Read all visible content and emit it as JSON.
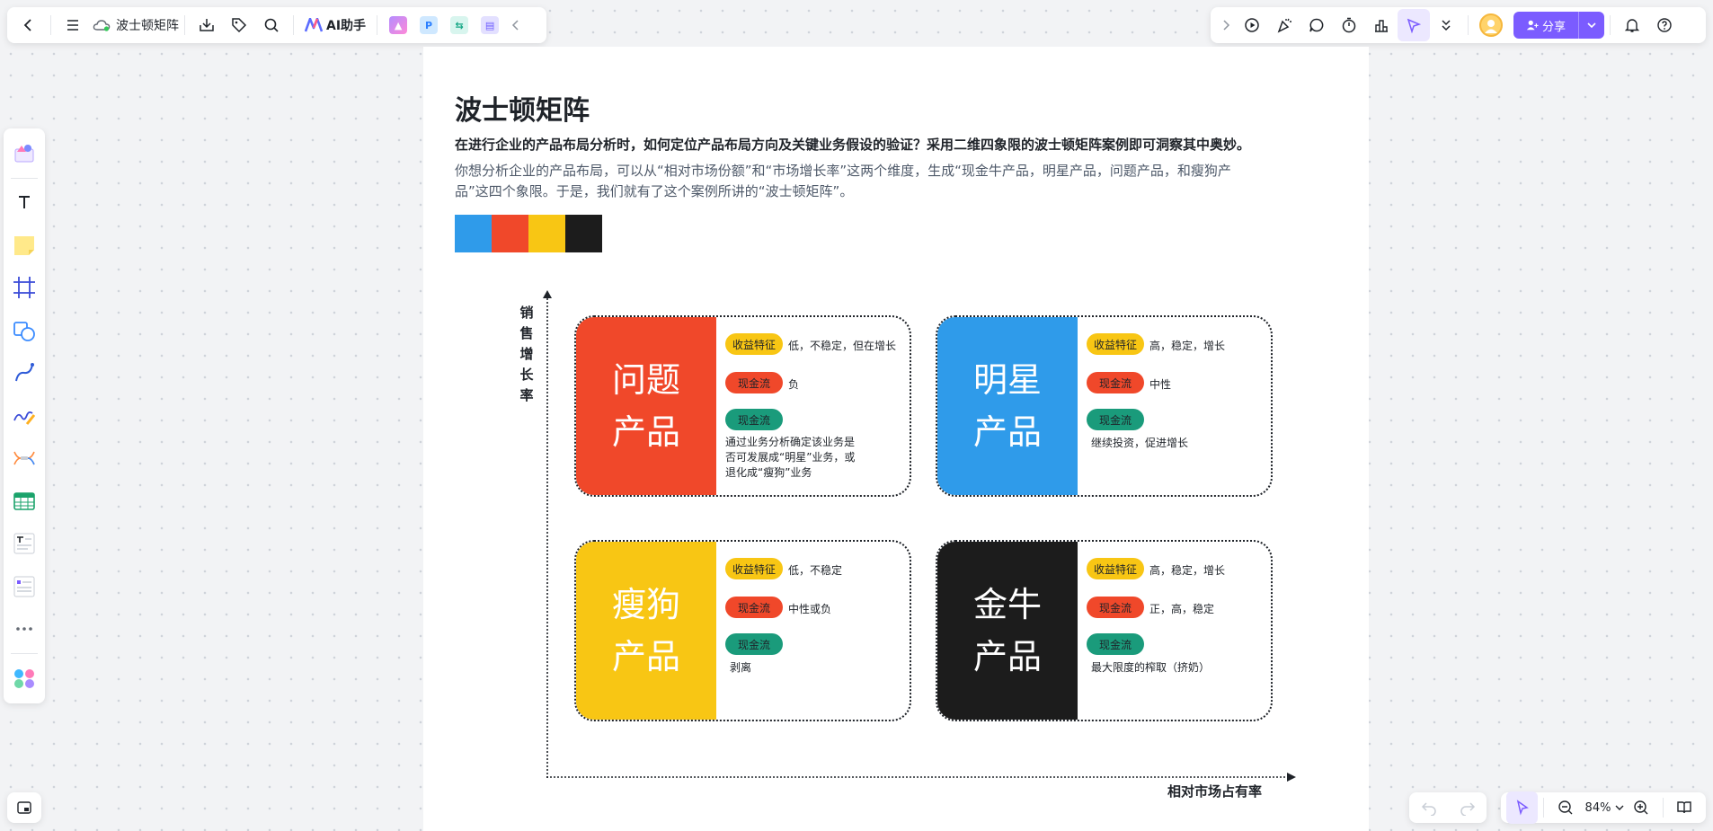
{
  "toolbar": {
    "doc_title": "波士顿矩阵",
    "ai_label": "AI助手"
  },
  "topbar_right": {
    "share_label": "分享"
  },
  "zoom": {
    "level": "84%"
  },
  "document": {
    "title": "波士顿矩阵",
    "lead": "在进行企业的产品布局分析时，如何定位产品布局方向及关键业务假设的验证？采用二维四象限的波士顿矩阵案例即可洞察其中奥妙。",
    "paragraph": "你想分析企业的产品布局，可以从“相对市场份额”和“市场增长率”这两个维度，生成“现金牛产品，明星产品，问题产品，和瘦狗产品”这四个象限。于是，我们就有了这个案例所讲的“波士顿矩阵”。",
    "swatches": [
      "#2f9bea",
      "#f0482a",
      "#f8c614",
      "#1c1c1c"
    ]
  },
  "matrix": {
    "y_axis_label": "销售增长率",
    "x_axis_label": "相对市场占有率",
    "pill_labels": {
      "revenue": "收益特征",
      "cashflow": "现金流"
    },
    "quadrants": {
      "question": {
        "title_line1": "问题",
        "title_line2": "产品",
        "color": "#f0482a",
        "revenue": "低，不稳定，但在增长",
        "cashflow": "负",
        "strategy": "通过业务分析确定该业务是否可发展成“明星”业务，或退化成“瘦狗”业务"
      },
      "star": {
        "title_line1": "明星",
        "title_line2": "产品",
        "color": "#2f9bea",
        "revenue": "高，稳定，增长",
        "cashflow": "中性",
        "strategy": "继续投资，促进增长"
      },
      "dog": {
        "title_line1": "瘦狗",
        "title_line2": "产品",
        "color": "#f8c614",
        "revenue": "低，不稳定",
        "cashflow": "中性或负",
        "strategy": "剥离"
      },
      "cow": {
        "title_line1": "金牛",
        "title_line2": "产品",
        "color": "#1c1c1c",
        "revenue": "高，稳定，增长",
        "cashflow": "正，高，稳定",
        "strategy": "最大限度的榨取（挤奶）"
      }
    }
  },
  "colors": {
    "pill_yellow": "#f8c614",
    "pill_red": "#f0482a",
    "pill_green": "#1a9b7b",
    "accent_purple": "#7b5cff"
  }
}
